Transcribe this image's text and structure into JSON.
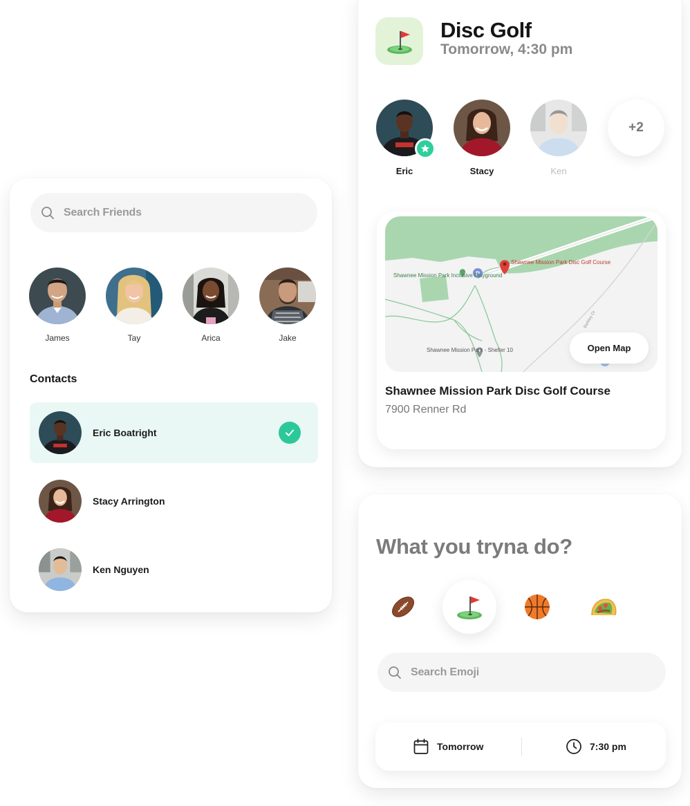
{
  "friends_panel": {
    "search_placeholder": "Search Friends",
    "friends": [
      {
        "name": "James"
      },
      {
        "name": "Tay"
      },
      {
        "name": "Arica"
      },
      {
        "name": "Jake"
      }
    ],
    "contacts_title": "Contacts",
    "contacts": [
      {
        "name": "Eric Boatright",
        "selected": true
      },
      {
        "name": "Stacy Arrington",
        "selected": false
      },
      {
        "name": "Ken Nguyen",
        "selected": false
      }
    ]
  },
  "event": {
    "icon": "golf-flag-emoji",
    "title": "Disc Golf",
    "time": "Tomorrow, 4:30 pm",
    "attendees": [
      {
        "name": "Eric",
        "host": true
      },
      {
        "name": "Stacy"
      },
      {
        "name": "Ken",
        "pending": true
      }
    ],
    "more_count": "+2",
    "location": {
      "map_labels": {
        "course": "Shawnee Mission Park Disc Golf Course",
        "playground": "Shawnee Mission Park Inclusive Playground",
        "shelter": "Shawnee Mission Park - Shelter 10",
        "road": "Barkley Dr"
      },
      "open_map_label": "Open Map",
      "name": "Shawnee Mission Park Disc Golf Course",
      "address": "7900 Renner Rd"
    }
  },
  "activity": {
    "question": "What you tryna do?",
    "emojis": [
      "football-emoji",
      "golf-flag-emoji",
      "basketball-emoji",
      "taco-emoji"
    ],
    "selected_emoji": "golf-flag-emoji",
    "search_placeholder": "Search Emoji",
    "date_label": "Tomorrow",
    "time_label": "7:30 pm"
  },
  "colors": {
    "accent_green": "#2cc89a",
    "selected_row_bg": "#e9f8f4",
    "map_park_green": "#a9d6af",
    "icon_bg": "#e2f3d8"
  }
}
